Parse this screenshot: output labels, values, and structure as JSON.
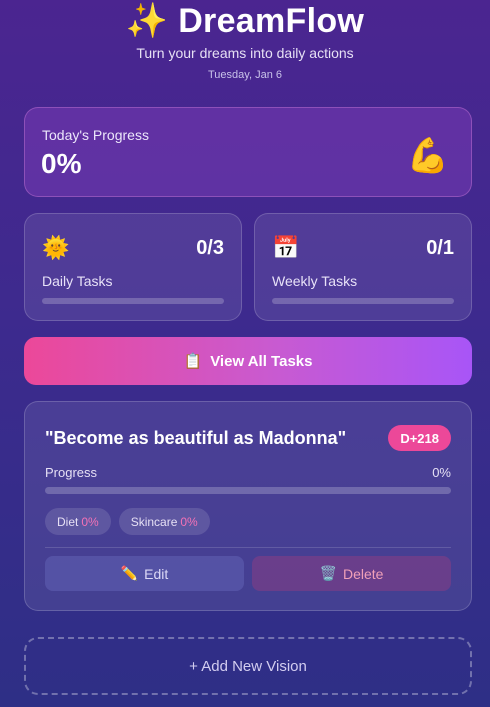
{
  "header": {
    "icon": "sparkles-icon",
    "title": "DreamFlow",
    "subtitle": "Turn your dreams into daily actions",
    "date": "Tuesday, Jan 6"
  },
  "progress_card": {
    "label": "Today's Progress",
    "value": "0%",
    "icon": "flexed-biceps-icon"
  },
  "stats": {
    "daily": {
      "icon": "sun-icon",
      "count": "0/3",
      "label": "Daily Tasks",
      "progress": 0
    },
    "weekly": {
      "icon": "calendar-icon",
      "count": "0/1",
      "label": "Weekly Tasks",
      "progress": 0
    }
  },
  "view_tasks_button": {
    "icon": "clipboard-icon",
    "label": "View All Tasks"
  },
  "vision": {
    "quote": "\"Become as beautiful as Madonna\"",
    "badge": "D+218",
    "progress_label": "Progress",
    "progress_value": "0%",
    "progress": 0,
    "tags": [
      {
        "name": "Diet",
        "percent": "0%"
      },
      {
        "name": "Skincare",
        "percent": "0%"
      }
    ],
    "edit_label": "Edit",
    "delete_label": "Delete"
  },
  "add_vision_label": "+ Add New Vision",
  "colors": {
    "accent": "#ec4899",
    "accent_end": "#a855f7",
    "background_top": "#4b2590",
    "background_bottom": "#2e2f86"
  }
}
